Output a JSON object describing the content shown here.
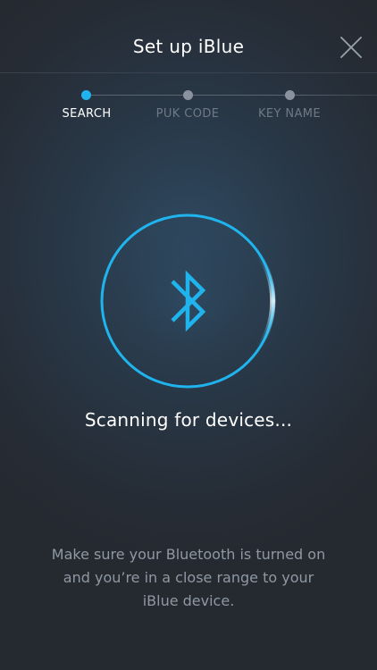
{
  "header": {
    "title": "Set up iBlue",
    "close_icon": "close-icon"
  },
  "steps": [
    {
      "label": "SEARCH",
      "active": true
    },
    {
      "label": "PUK CODE",
      "active": false
    },
    {
      "label": "KEY NAME",
      "active": false
    }
  ],
  "scanner": {
    "icon": "bluetooth-icon",
    "accent_color": "#1fb4ee"
  },
  "status": {
    "text": "Scanning for devices..."
  },
  "help": {
    "text": "Make sure your Bluetooth is turned on and you’re in a close range to your iBlue device."
  }
}
